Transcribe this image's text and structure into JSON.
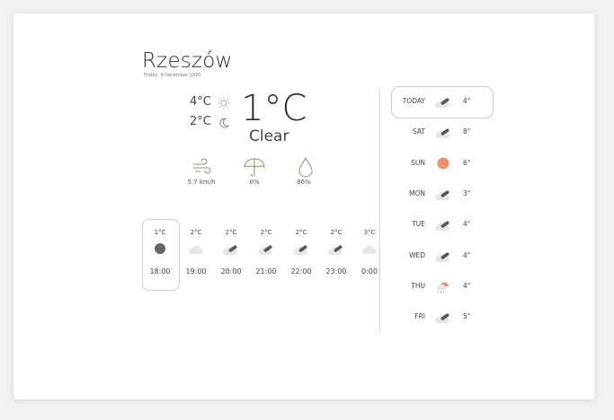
{
  "city": "Rzeszów",
  "date": "Friday, 4 December 2020",
  "current": {
    "high": "4°C",
    "low": "2°C",
    "temp": "1°C",
    "condition": "Clear"
  },
  "stats": {
    "wind": "5.7 km/h",
    "precip": "0%",
    "humidity": "86%"
  },
  "hourly": [
    {
      "temp": "1°C",
      "time": "18:00",
      "icon": "moon-filled-icon"
    },
    {
      "temp": "2°C",
      "time": "19:00",
      "icon": "cloud-icon"
    },
    {
      "temp": "2°C",
      "time": "20:00",
      "icon": "cloud-moon-icon"
    },
    {
      "temp": "2°C",
      "time": "21:00",
      "icon": "cloud-moon-icon"
    },
    {
      "temp": "2°C",
      "time": "22:00",
      "icon": "cloud-moon-icon"
    },
    {
      "temp": "2°C",
      "time": "23:00",
      "icon": "cloud-moon-icon"
    },
    {
      "temp": "3°C",
      "time": "0:00",
      "icon": "cloud-icon"
    }
  ],
  "daily": [
    {
      "day": "TODAY",
      "temp": "4°",
      "icon": "cloud-moon-icon"
    },
    {
      "day": "SAT",
      "temp": "8°",
      "icon": "cloud-moon-icon"
    },
    {
      "day": "SUN",
      "temp": "6°",
      "icon": "sun-icon"
    },
    {
      "day": "MON",
      "temp": "3°",
      "icon": "cloud-moon-icon"
    },
    {
      "day": "TUE",
      "temp": "4°",
      "icon": "cloud-moon-icon"
    },
    {
      "day": "WED",
      "temp": "4°",
      "icon": "cloud-moon-icon"
    },
    {
      "day": "THU",
      "temp": "4°",
      "icon": "rain-sun-icon"
    },
    {
      "day": "FRI",
      "temp": "5°",
      "icon": "cloud-moon-icon"
    }
  ],
  "colors": {
    "accent_sun": "#ee8f72",
    "moon": "#666666",
    "cloud": "#e6e6e6"
  }
}
